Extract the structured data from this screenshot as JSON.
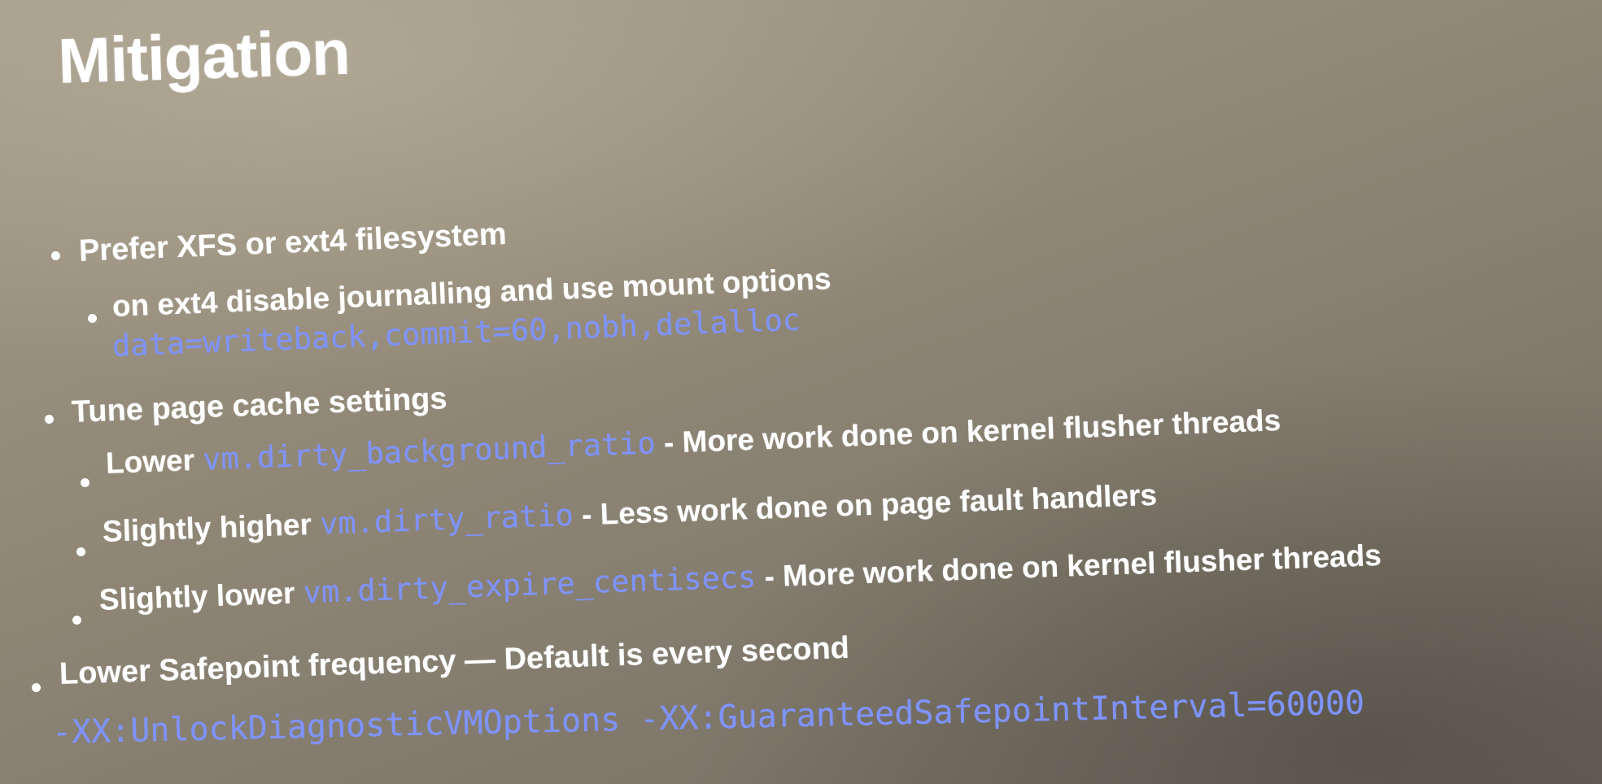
{
  "slide": {
    "title": "Mitigation",
    "item1": {
      "text": "Prefer XFS or ext4 filesystem",
      "sub": {
        "text": "on ext4 disable journalling and use mount options",
        "code": "data=writeback,commit=60,nobh,delalloc"
      }
    },
    "item2": {
      "text": "Tune page cache settings",
      "subs": [
        {
          "prefix": "Lower ",
          "code": "vm.dirty_background_ratio",
          "suffix": " - More work done on kernel flusher threads"
        },
        {
          "prefix": "Slightly higher ",
          "code": "vm.dirty_ratio",
          "suffix": " - Less work done on page fault handlers"
        },
        {
          "prefix": "Slightly lower ",
          "code": "vm.dirty_expire_centisecs",
          "suffix": " - More work done on kernel flusher threads"
        }
      ]
    },
    "item3": {
      "text": "Lower Safepoint frequency — Default is every second",
      "code": "-XX:UnlockDiagnosticVMOptions -XX:GuaranteedSafepointInterval=60000"
    }
  },
  "colors": {
    "text": "#ffffff",
    "code": "#7f93ff"
  }
}
